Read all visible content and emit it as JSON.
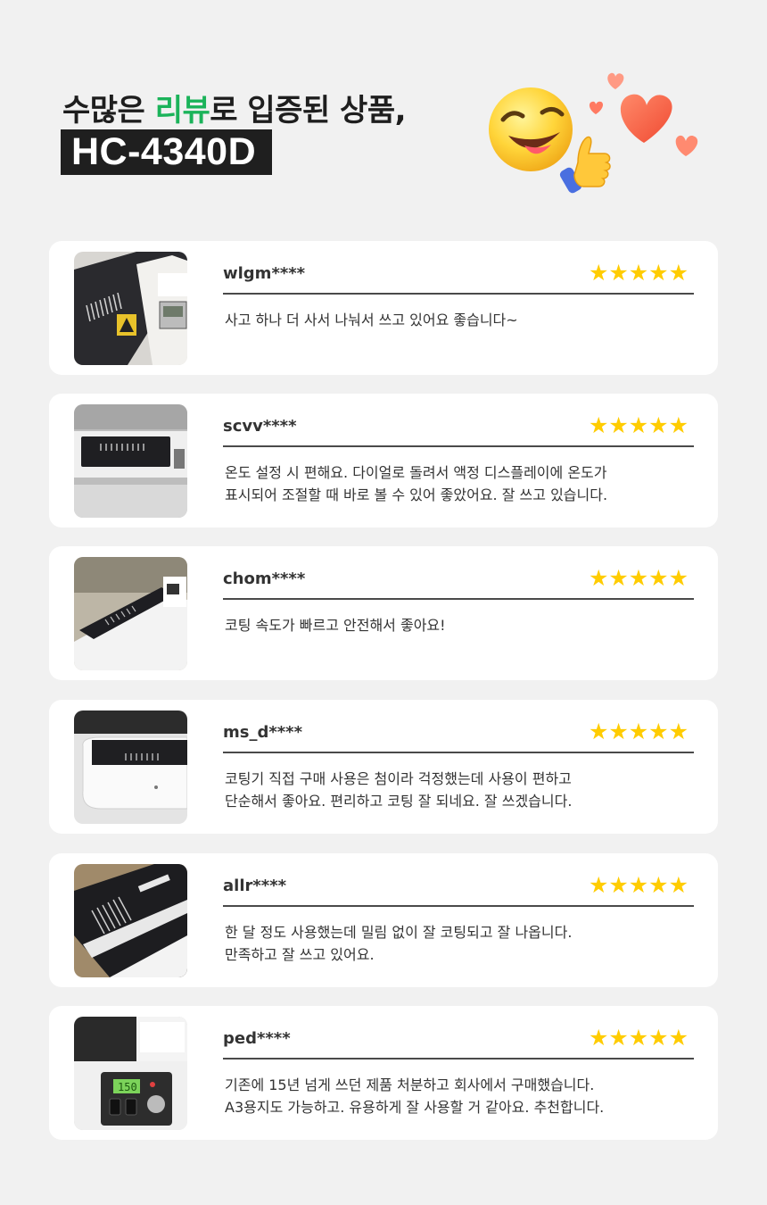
{
  "header": {
    "line1_prefix": "수많은 ",
    "line1_highlight": "리뷰",
    "line1_suffix": "로 입증된 상품,",
    "model": "HC-4340D",
    "highlight_color": "#1bb35a"
  },
  "decoration": {
    "icons": [
      "winking-tongue-emoji-icon",
      "thumbs-up-icon",
      "heart-icon"
    ]
  },
  "star_color": "#ffcc00",
  "reviews": [
    {
      "user": "wlgm****",
      "rating": 5,
      "stars": "★★★★★",
      "text": "사고 하나 더 사서 나눠서 쓰고 있어요 좋습니다~"
    },
    {
      "user": "scvv****",
      "rating": 5,
      "stars": "★★★★★",
      "text": "온도 설정 시 편해요. 다이얼로 돌려서 액정 디스플레이에 온도가\n표시되어 조절할 때 바로 볼 수 있어 좋았어요. 잘 쓰고 있습니다."
    },
    {
      "user": "chom****",
      "rating": 5,
      "stars": "★★★★★",
      "text": "코팅 속도가 빠르고 안전해서 좋아요!"
    },
    {
      "user": "ms_d****",
      "rating": 5,
      "stars": "★★★★★",
      "text": "코팅기 직접 구매 사용은 첨이라 걱정했는데 사용이 편하고\n단순해서 좋아요. 편리하고 코팅 잘 되네요. 잘 쓰겠습니다."
    },
    {
      "user": "allr****",
      "rating": 5,
      "stars": "★★★★★",
      "text": "한 달 정도 사용했는데 밀림 없이 잘 코팅되고 잘 나옵니다.\n만족하고 잘 쓰고 있어요."
    },
    {
      "user": "ped****",
      "rating": 5,
      "stars": "★★★★★",
      "text": "기존에 15년 넘게 쓰던 제품 처분하고 회사에서 구매했습니다.\nA3용지도 가능하고. 유용하게 잘 사용할 거 같아요. 추천합니다."
    }
  ],
  "photo_display": {
    "temperature": "150"
  }
}
